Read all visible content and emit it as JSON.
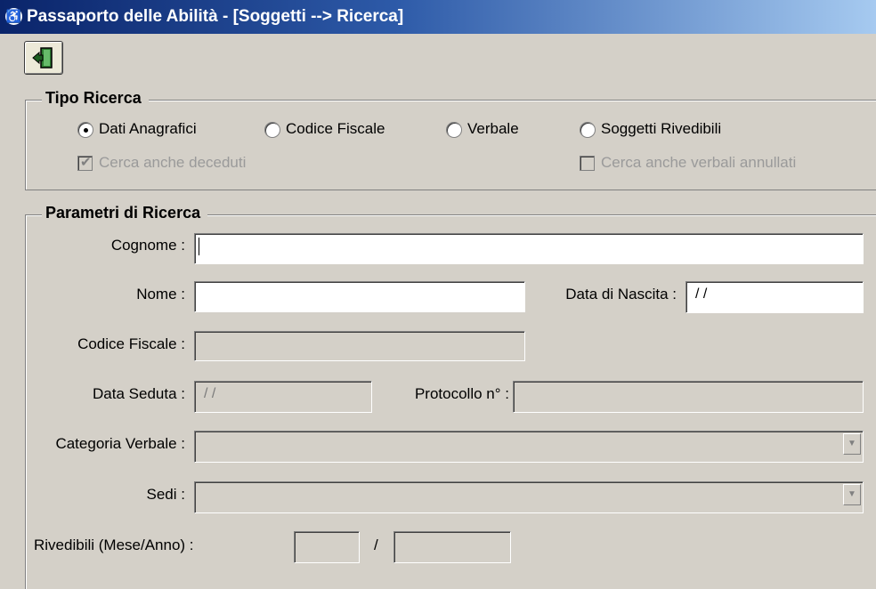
{
  "window": {
    "title": "Passaporto delle Abilità - [Soggetti --> Ricerca]"
  },
  "icons": {
    "app": "wheelchair-icon",
    "exit": "exit-door-icon"
  },
  "tipo_ricerca": {
    "legend": "Tipo Ricerca",
    "options": [
      {
        "label": "Dati Anagrafici",
        "selected": true
      },
      {
        "label": "Codice Fiscale",
        "selected": false
      },
      {
        "label": "Verbale",
        "selected": false
      },
      {
        "label": "Soggetti Rivedibili",
        "selected": false
      }
    ],
    "checkboxes": [
      {
        "label": "Cerca anche deceduti",
        "checked": true,
        "disabled": true
      },
      {
        "label": "Cerca anche verbali annullati",
        "checked": false,
        "disabled": true
      }
    ]
  },
  "parametri": {
    "legend": "Parametri di Ricerca",
    "cognome_label": "Cognome :",
    "cognome_value": "",
    "nome_label": "Nome :",
    "nome_value": "",
    "data_nascita_label": "Data di Nascita :",
    "data_nascita_value": "/ /",
    "codice_fiscale_label": "Codice Fiscale :",
    "codice_fiscale_value": "",
    "data_seduta_label": "Data Seduta :",
    "data_seduta_value": "/ /",
    "protocollo_label": "Protocollo n° :",
    "protocollo_value": "",
    "categoria_label": "Categoria Verbale :",
    "categoria_value": "",
    "sedi_label": "Sedi :",
    "sedi_value": "",
    "rivedibili_label": "Rivedibili (Mese/Anno) :",
    "rivedibili_mese": "",
    "rivedibili_separator": "/",
    "rivedibili_anno": ""
  }
}
